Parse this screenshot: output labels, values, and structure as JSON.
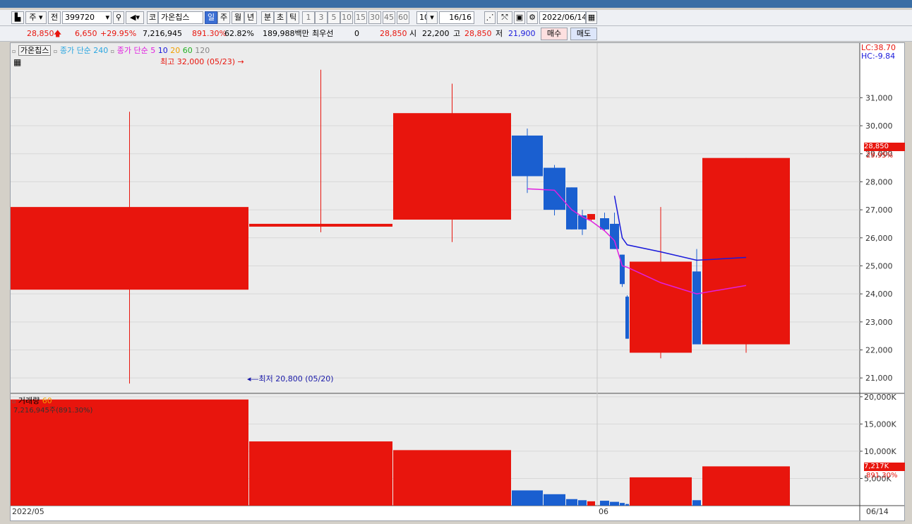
{
  "toolbar": {
    "period_type": "주",
    "prev_label": "전",
    "code": "399720",
    "name_prefix": "코",
    "stock_name": "가온칩스",
    "periods": [
      "일",
      "주",
      "월",
      "년",
      "분",
      "초",
      "틱"
    ],
    "active_period": "일",
    "intervals": [
      "1",
      "3",
      "5",
      "10",
      "15",
      "30",
      "45",
      "60"
    ],
    "interval_value": "10",
    "page": "16/16",
    "date": "2022/06/14"
  },
  "quote": {
    "price": "28,850",
    "change": "6,650",
    "change_pct": "+29.95%",
    "volume": "7,216,945",
    "volume_pct": "891.30%",
    "ratio": "62.82%",
    "trade_value": "189,988백만",
    "priority_label": "최우선",
    "priority_value": "0",
    "priority_price": "28,850",
    "open_label": "시",
    "open": "22,200",
    "high_label": "고",
    "high": "28,850",
    "low_label": "저",
    "low": "21,900",
    "buy_label": "매수",
    "sell_label": "매도"
  },
  "price_legend": {
    "name": "가온칩스",
    "ma_long": "종가 단순 240",
    "ma_short": "종가 단순",
    "ma_periods": [
      "5",
      "10",
      "20",
      "60",
      "120"
    ]
  },
  "annotations": {
    "high": "최고 32,000 (05/23)",
    "low": "최저 20,800 (05/20)",
    "lc": "LC:38.70",
    "hc": "HC:-9.84",
    "current_price": "28,850",
    "current_pct": "29.95%",
    "vol_current": "7,217K",
    "vol_pct": "891.30%"
  },
  "volume_legend": {
    "name": "거래량",
    "period": "60",
    "value": "7,216,945주(891.30%)"
  },
  "x_axis": {
    "start": "2022/05",
    "mid": "06",
    "end": "06/14"
  },
  "colors": {
    "up": "#e8150d",
    "down": "#1a5fd0",
    "ma5": "#e020e0",
    "ma10": "#1a1adb"
  },
  "chart_data": [
    {
      "type": "candlestick",
      "price_ticks": [
        21000,
        22000,
        23000,
        24000,
        25000,
        26000,
        27000,
        28000,
        29000,
        30000,
        31000
      ],
      "ylim": [
        20450,
        32950
      ],
      "candles": [
        {
          "o": 24150,
          "h": 30500,
          "l": 20800,
          "c": 27100,
          "up": true
        },
        {
          "o": 26400,
          "h": 32000,
          "l": 26200,
          "c": 26500,
          "up": true
        },
        {
          "o": 26650,
          "h": 31500,
          "l": 25850,
          "c": 30450,
          "up": true
        },
        {
          "o": 29650,
          "h": 29900,
          "l": 27600,
          "c": 28200,
          "up": false
        },
        {
          "o": 28500,
          "h": 28600,
          "l": 26800,
          "c": 27000,
          "up": false
        },
        {
          "o": 27800,
          "h": 27800,
          "l": 26300,
          "c": 26300,
          "up": false
        },
        {
          "o": 26800,
          "h": 27000,
          "l": 26100,
          "c": 26300,
          "up": false
        },
        {
          "o": 26650,
          "h": 26850,
          "l": 26600,
          "c": 26850,
          "up": true
        },
        {
          "o": 26700,
          "h": 26900,
          "l": 26250,
          "c": 26300,
          "up": false
        },
        {
          "o": 26500,
          "h": 26900,
          "l": 25600,
          "c": 25600,
          "up": false
        },
        {
          "o": 25400,
          "h": 25400,
          "l": 24250,
          "c": 24350,
          "up": false
        },
        {
          "o": 23900,
          "h": 23950,
          "l": 22400,
          "c": 22400,
          "up": false
        },
        {
          "o": 21900,
          "h": 27100,
          "l": 21700,
          "c": 25150,
          "up": true
        },
        {
          "o": 24800,
          "h": 25600,
          "l": 22200,
          "c": 22200,
          "up": false
        },
        {
          "o": 22200,
          "h": 28850,
          "l": 21900,
          "c": 28850,
          "up": true
        }
      ],
      "ma5": [
        null,
        null,
        null,
        27750,
        27700,
        27000,
        26750,
        26600,
        26250,
        25900,
        25000,
        24950,
        24400,
        24000,
        24300
      ],
      "ma10": [
        null,
        null,
        null,
        null,
        null,
        null,
        null,
        null,
        null,
        27500,
        26000,
        25750,
        25500,
        25200,
        25300
      ]
    },
    {
      "type": "bar",
      "volume_ticks": [
        "20,000K",
        "15,000K",
        "10,000K",
        "5,000K"
      ],
      "volume_tick_values": [
        20000,
        15000,
        10000,
        5000
      ],
      "ylim": [
        0,
        20500
      ],
      "values": [
        19500,
        11800,
        10200,
        2800,
        2100,
        1200,
        1000,
        800,
        900,
        700,
        500,
        300,
        5200,
        1000,
        7217
      ]
    }
  ]
}
